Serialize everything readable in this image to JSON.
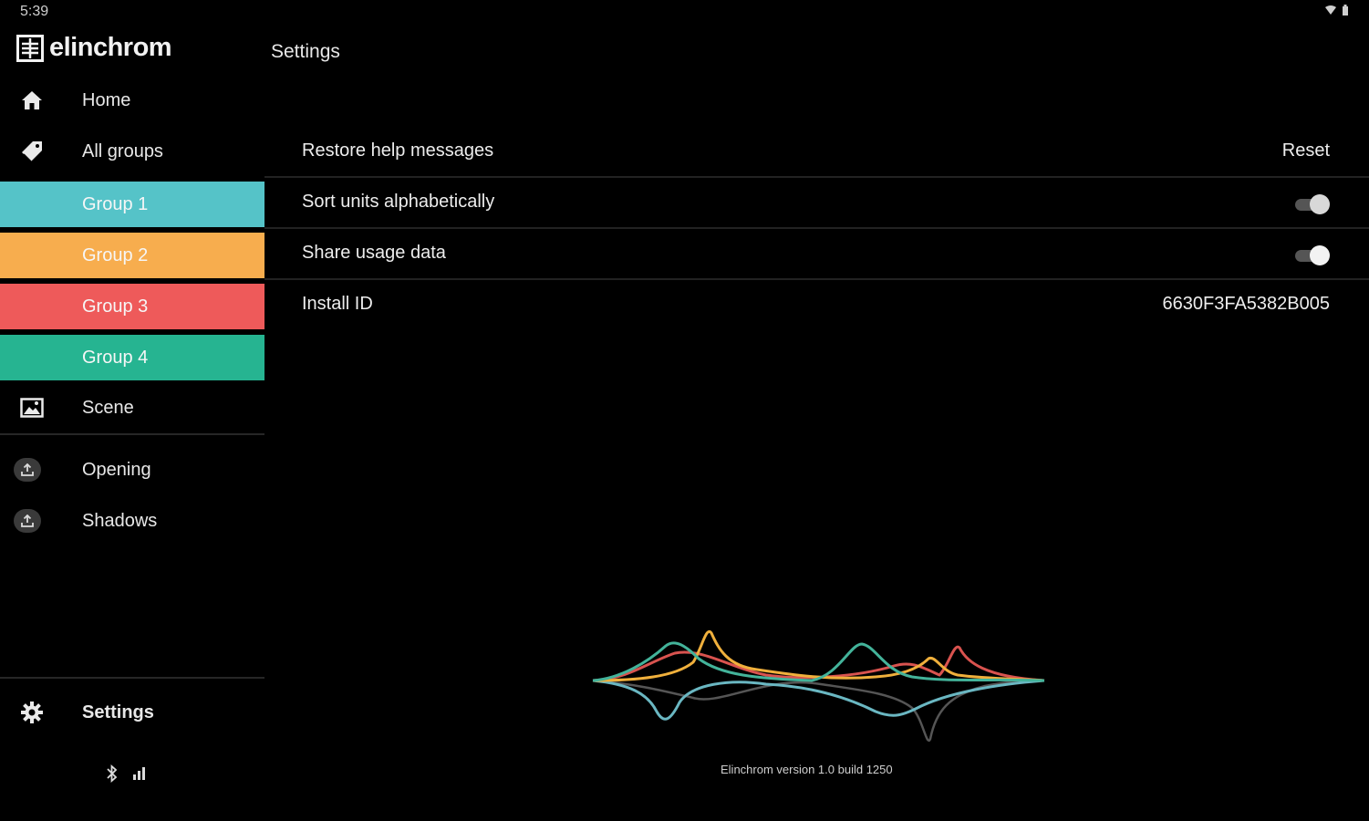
{
  "status_bar": {
    "time": "5:39"
  },
  "brand": {
    "name": "elinchrom"
  },
  "sidebar": {
    "items": [
      {
        "label": "Home",
        "icon": "home-icon"
      },
      {
        "label": "All groups",
        "icon": "tag-icon"
      }
    ],
    "groups": [
      {
        "label": "Group 1",
        "color": "#55c3c8"
      },
      {
        "label": "Group 2",
        "color": "#f7ad4e"
      },
      {
        "label": "Group 3",
        "color": "#ee5a5a"
      },
      {
        "label": "Group 4",
        "color": "#26b491"
      }
    ],
    "scene": {
      "label": "Scene",
      "icon": "image-icon"
    },
    "scenes": [
      {
        "label": "Opening",
        "icon": "upload-icon"
      },
      {
        "label": "Shadows",
        "icon": "upload-icon"
      }
    ],
    "settings": {
      "label": "Settings",
      "icon": "gear-icon"
    }
  },
  "header": {
    "title": "Settings"
  },
  "settings": {
    "restore_help": {
      "label": "Restore help messages",
      "action": "Reset"
    },
    "sort_units": {
      "label": "Sort units alphabetically",
      "enabled": true
    },
    "share_usage": {
      "label": "Share usage data",
      "enabled": true
    },
    "install_id": {
      "label": "Install ID",
      "value": "6630F3FA5382B005"
    }
  },
  "footer": {
    "version": "Elinchrom version 1.0 build 1250"
  },
  "colors": {
    "teal": "#55c3c8",
    "orange": "#f7ad4e",
    "red": "#ee5a5a",
    "green": "#26b491",
    "background": "#000000"
  }
}
